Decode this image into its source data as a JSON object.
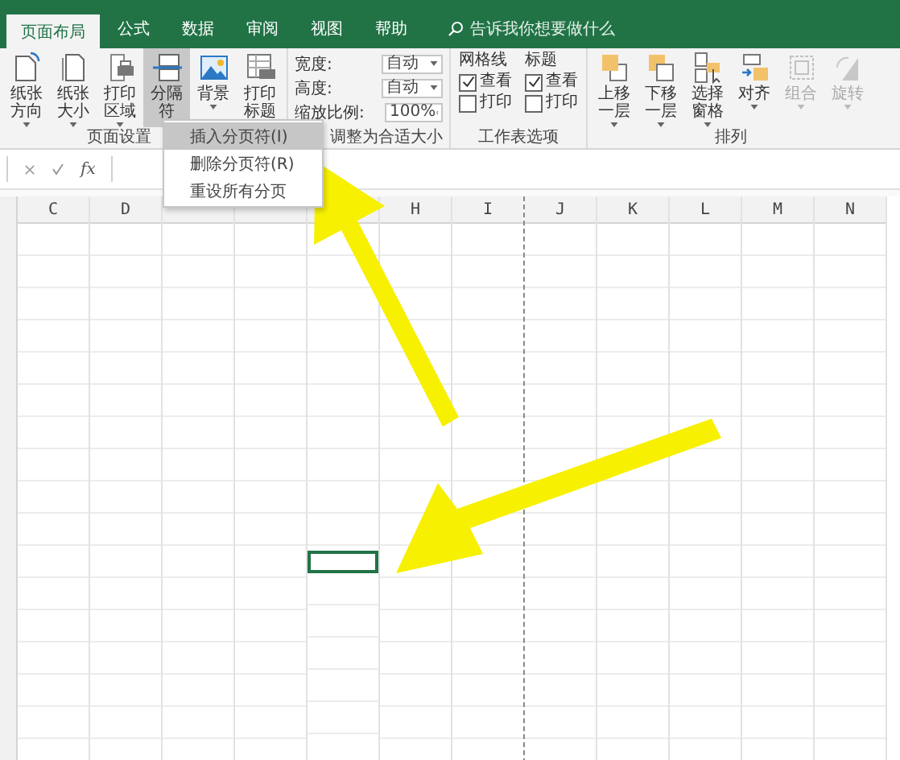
{
  "tabs": [
    {
      "label": "页面布局",
      "selected": true
    },
    {
      "label": "公式",
      "selected": false
    },
    {
      "label": "数据",
      "selected": false
    },
    {
      "label": "审阅",
      "selected": false
    },
    {
      "label": "视图",
      "selected": false
    },
    {
      "label": "帮助",
      "selected": false
    }
  ],
  "search": {
    "placeholder": "告诉我你想要做什么"
  },
  "page_setup": {
    "label": "页面设置",
    "buttons": [
      {
        "label": "纸张方向",
        "selected": false
      },
      {
        "label": "纸张大小",
        "selected": false
      },
      {
        "label": "打印区域",
        "selected": false
      },
      {
        "label": "分隔符",
        "selected": true
      },
      {
        "label": "背景",
        "selected": false
      },
      {
        "label": "打印标题",
        "selected": false
      }
    ]
  },
  "scale_to_fit": {
    "label": "调整为合适大小",
    "fields": [
      {
        "label": "宽度:",
        "value": "自动",
        "kind": "dropdown"
      },
      {
        "label": "高度:",
        "value": "自动",
        "kind": "dropdown"
      },
      {
        "label": "缩放比例:",
        "value": "100%",
        "kind": "spinner"
      }
    ]
  },
  "sheet_options": {
    "label": "工作表选项",
    "columns": [
      {
        "title": "网格线",
        "options": [
          {
            "label": "查看",
            "checked": true
          },
          {
            "label": "打印",
            "checked": false
          }
        ]
      },
      {
        "title": "标题",
        "options": [
          {
            "label": "查看",
            "checked": true
          },
          {
            "label": "打印",
            "checked": false
          }
        ]
      }
    ]
  },
  "arrange": {
    "label": "排列",
    "buttons": [
      {
        "label": "上移一层",
        "disabled": false
      },
      {
        "label": "下移一层",
        "disabled": false
      },
      {
        "label": "选择窗格",
        "disabled": false
      },
      {
        "label": "对齐",
        "disabled": false
      },
      {
        "label": "组合",
        "disabled": true
      },
      {
        "label": "旋转",
        "disabled": true
      }
    ]
  },
  "menu": {
    "items": [
      {
        "label": "插入分页符(I)",
        "selected": true
      },
      {
        "label": "删除分页符(R)",
        "selected": false
      },
      {
        "label": "重设所有分页",
        "selected": false
      }
    ]
  },
  "formula_bar": {
    "function_label": "fx"
  },
  "sheet": {
    "columns": [
      {
        "label": "C",
        "page_break": false,
        "selected_cell": false
      },
      {
        "label": "D",
        "page_break": false,
        "selected_cell": false
      },
      {
        "page_break": false,
        "selected_cell": false
      },
      {
        "page_break": false,
        "selected_cell": false
      },
      {
        "page_break": false,
        "selected_cell": true
      },
      {
        "label": "H",
        "page_break": false,
        "selected_cell": false
      },
      {
        "label": "I",
        "page_break": true,
        "selected_cell": false
      },
      {
        "label": "J",
        "page_break": false,
        "selected_cell": false
      },
      {
        "label": "K",
        "page_break": false,
        "selected_cell": false
      },
      {
        "label": "L",
        "page_break": false,
        "selected_cell": false
      },
      {
        "label": "M",
        "page_break": false,
        "selected_cell": false
      },
      {
        "label": "N",
        "page_break": false,
        "selected_cell": false
      }
    ]
  },
  "annotations": [
    {
      "kind": "arrow"
    },
    {
      "kind": "arrow"
    }
  ]
}
